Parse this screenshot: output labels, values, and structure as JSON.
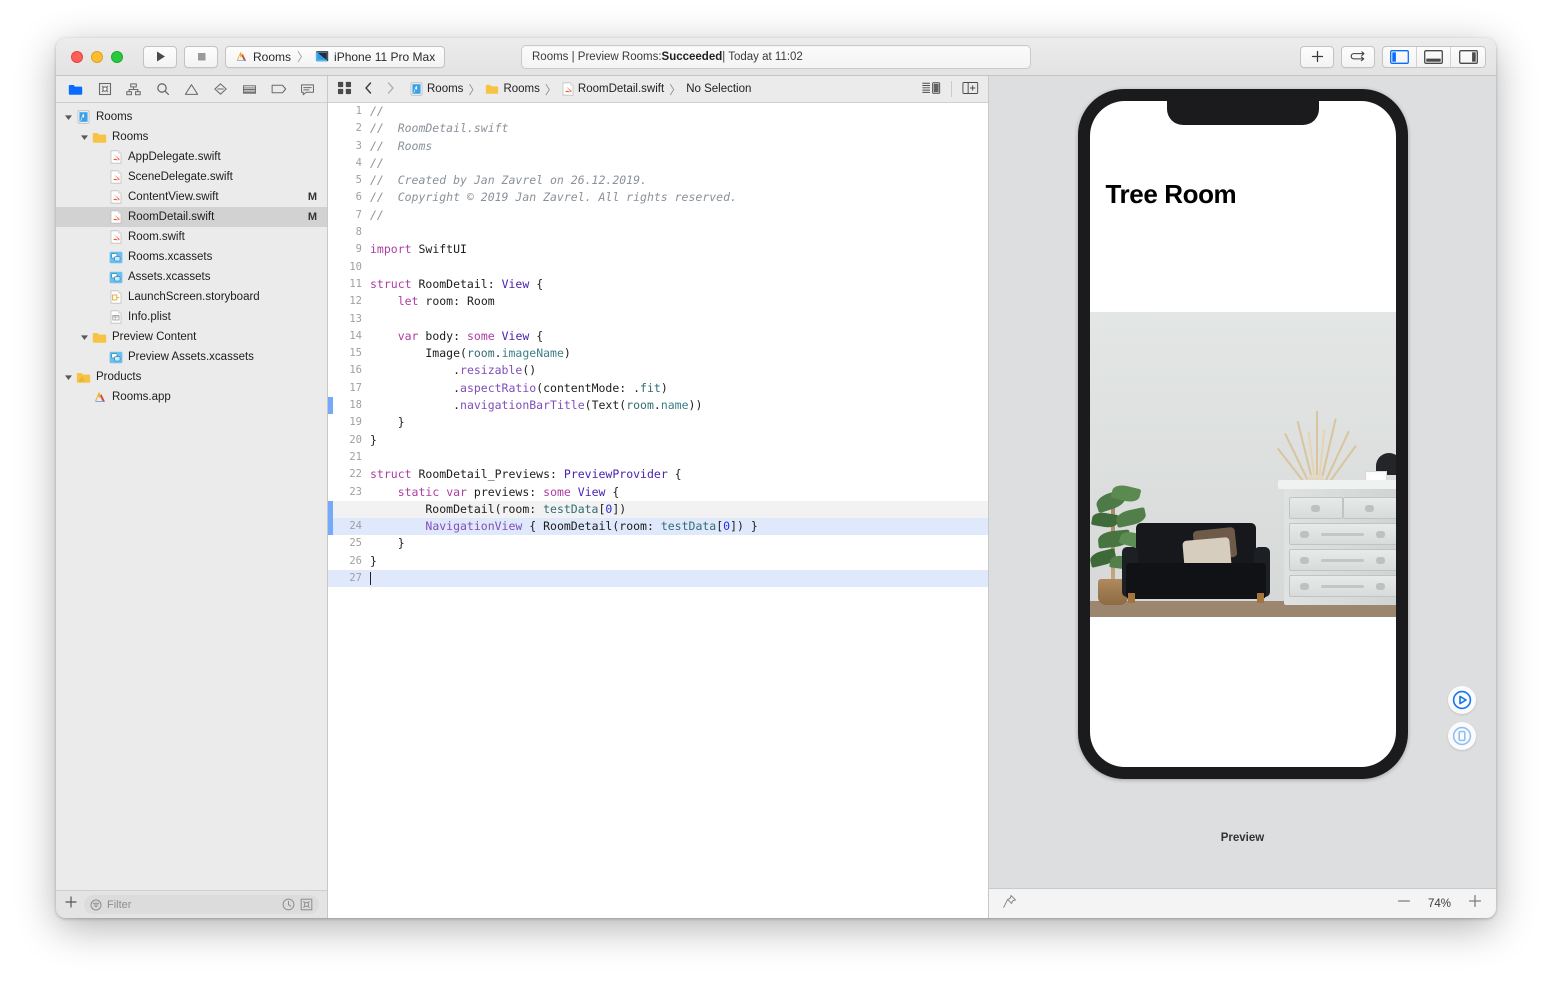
{
  "window": {
    "traffic_lights": [
      "close",
      "minimize",
      "zoom"
    ],
    "toolbar": {
      "run_label": "Run",
      "stop_label": "Stop",
      "scheme_name": "Rooms",
      "destination_name": "iPhone 11 Pro Max",
      "scheme_separator": "〉",
      "add_label": "+",
      "status": {
        "prefix": "Rooms | Preview Rooms: ",
        "result": "Succeeded",
        "suffix": " | Today at 11:02"
      },
      "editor_segments": [
        "standard-editor",
        "assistant-editor",
        "version-editor"
      ],
      "panel_toggles": [
        "navigator",
        "debug-area",
        "inspector"
      ]
    }
  },
  "navigator": {
    "tabs": [
      "project-navigator",
      "source-control-navigator",
      "symbol-navigator",
      "find-navigator",
      "issue-navigator",
      "test-navigator",
      "debug-navigator",
      "breakpoint-navigator",
      "report-navigator"
    ],
    "selected_tab": "project-navigator",
    "tree": [
      {
        "label": "Rooms",
        "icon": "xcode-project-icon",
        "depth": 0,
        "twisty": "down",
        "modified": "",
        "selected": false
      },
      {
        "label": "Rooms",
        "icon": "folder-icon",
        "depth": 1,
        "twisty": "down",
        "modified": "",
        "selected": false
      },
      {
        "label": "AppDelegate.swift",
        "icon": "swift-file-icon",
        "depth": 2,
        "twisty": "",
        "modified": "",
        "selected": false
      },
      {
        "label": "SceneDelegate.swift",
        "icon": "swift-file-icon",
        "depth": 2,
        "twisty": "",
        "modified": "",
        "selected": false
      },
      {
        "label": "ContentView.swift",
        "icon": "swift-file-icon",
        "depth": 2,
        "twisty": "",
        "modified": "M",
        "selected": false
      },
      {
        "label": "RoomDetail.swift",
        "icon": "swift-file-icon",
        "depth": 2,
        "twisty": "",
        "modified": "M",
        "selected": true
      },
      {
        "label": "Room.swift",
        "icon": "swift-file-icon",
        "depth": 2,
        "twisty": "",
        "modified": "",
        "selected": false
      },
      {
        "label": "Rooms.xcassets",
        "icon": "xcassets-icon",
        "depth": 2,
        "twisty": "",
        "modified": "",
        "selected": false
      },
      {
        "label": "Assets.xcassets",
        "icon": "xcassets-icon",
        "depth": 2,
        "twisty": "",
        "modified": "",
        "selected": false
      },
      {
        "label": "LaunchScreen.storyboard",
        "icon": "storyboard-icon",
        "depth": 2,
        "twisty": "",
        "modified": "",
        "selected": false
      },
      {
        "label": "Info.plist",
        "icon": "plist-icon",
        "depth": 2,
        "twisty": "",
        "modified": "",
        "selected": false
      },
      {
        "label": "Preview Content",
        "icon": "folder-icon",
        "depth": 1,
        "twisty": "down",
        "modified": "",
        "selected": false
      },
      {
        "label": "Preview Assets.xcassets",
        "icon": "xcassets-icon",
        "depth": 2,
        "twisty": "",
        "modified": "",
        "selected": false
      },
      {
        "label": "Products",
        "icon": "folder-build-icon",
        "depth": 0,
        "twisty": "down",
        "modified": "",
        "selected": false
      },
      {
        "label": "Rooms.app",
        "icon": "app-icon",
        "depth": 1,
        "twisty": "",
        "modified": "",
        "selected": false
      }
    ],
    "bottom_bar": {
      "add_label": "+",
      "filter_placeholder": "Filter",
      "recent_icon": "clock-icon",
      "scm_icon": "source-control-icon"
    }
  },
  "editor": {
    "jumpbar": {
      "related_items_icon": "related-items-icon",
      "back_icon": "chevron-left-icon",
      "forward_icon": "chevron-right-icon",
      "crumbs": [
        {
          "label": "Rooms",
          "icon": "xcode-project-icon"
        },
        {
          "label": "Rooms",
          "icon": "folder-icon"
        },
        {
          "label": "RoomDetail.swift",
          "icon": "swift-file-icon"
        },
        {
          "label": "No Selection",
          "icon": ""
        }
      ],
      "separator": "〉",
      "right_icons": [
        "minimap-toggle-icon",
        "add-editor-icon"
      ]
    },
    "filename": "RoomDetail.swift",
    "lines": [
      {
        "n": "1",
        "tokens": [
          {
            "t": "//",
            "c": "c"
          }
        ],
        "state": "",
        "gutter": false
      },
      {
        "n": "2",
        "tokens": [
          {
            "t": "//  RoomDetail.swift",
            "c": "c"
          }
        ],
        "state": "",
        "gutter": false
      },
      {
        "n": "3",
        "tokens": [
          {
            "t": "//  Rooms",
            "c": "c"
          }
        ],
        "state": "",
        "gutter": false
      },
      {
        "n": "4",
        "tokens": [
          {
            "t": "//",
            "c": "c"
          }
        ],
        "state": "",
        "gutter": false
      },
      {
        "n": "5",
        "tokens": [
          {
            "t": "//  Created by Jan Zavrel on 26.12.2019.",
            "c": "c"
          }
        ],
        "state": "",
        "gutter": false
      },
      {
        "n": "6",
        "tokens": [
          {
            "t": "//  Copyright © 2019 Jan Zavrel. All rights reserved.",
            "c": "c"
          }
        ],
        "state": "",
        "gutter": false
      },
      {
        "n": "7",
        "tokens": [
          {
            "t": "//",
            "c": "c"
          }
        ],
        "state": "",
        "gutter": false
      },
      {
        "n": "8",
        "tokens": [],
        "state": "",
        "gutter": false
      },
      {
        "n": "9",
        "tokens": [
          {
            "t": "import",
            "c": "k"
          },
          {
            "t": " SwiftUI",
            "c": ""
          }
        ],
        "state": "",
        "gutter": false
      },
      {
        "n": "10",
        "tokens": [],
        "state": "",
        "gutter": false
      },
      {
        "n": "11",
        "tokens": [
          {
            "t": "struct",
            "c": "k"
          },
          {
            "t": " RoomDetail",
            "c": ""
          },
          {
            "t": ": ",
            "c": ""
          },
          {
            "t": "View",
            "c": "ty"
          },
          {
            "t": " {",
            "c": ""
          }
        ],
        "state": "",
        "gutter": false
      },
      {
        "n": "12",
        "tokens": [
          {
            "t": "    ",
            "c": ""
          },
          {
            "t": "let",
            "c": "k"
          },
          {
            "t": " room",
            "c": ""
          },
          {
            "t": ": ",
            "c": ""
          },
          {
            "t": "Room",
            "c": ""
          }
        ],
        "state": "",
        "gutter": false
      },
      {
        "n": "13",
        "tokens": [],
        "state": "",
        "gutter": false
      },
      {
        "n": "14",
        "tokens": [
          {
            "t": "    ",
            "c": ""
          },
          {
            "t": "var",
            "c": "k"
          },
          {
            "t": " body",
            "c": ""
          },
          {
            "t": ": ",
            "c": ""
          },
          {
            "t": "some",
            "c": "k"
          },
          {
            "t": " ",
            "c": ""
          },
          {
            "t": "View",
            "c": "ty"
          },
          {
            "t": " {",
            "c": ""
          }
        ],
        "state": "",
        "gutter": false
      },
      {
        "n": "15",
        "tokens": [
          {
            "t": "        Image(",
            "c": ""
          },
          {
            "t": "room",
            "c": "m"
          },
          {
            "t": ".",
            "c": ""
          },
          {
            "t": "imageName",
            "c": "prop"
          },
          {
            "t": ")",
            "c": ""
          }
        ],
        "state": "",
        "gutter": false
      },
      {
        "n": "16",
        "tokens": [
          {
            "t": "            .",
            "c": ""
          },
          {
            "t": "resizable",
            "c": "p"
          },
          {
            "t": "()",
            "c": ""
          }
        ],
        "state": "",
        "gutter": false
      },
      {
        "n": "17",
        "tokens": [
          {
            "t": "            .",
            "c": ""
          },
          {
            "t": "aspectRatio",
            "c": "p"
          },
          {
            "t": "(contentMode: .",
            "c": ""
          },
          {
            "t": "fit",
            "c": "m"
          },
          {
            "t": ")",
            "c": ""
          }
        ],
        "state": "",
        "gutter": false
      },
      {
        "n": "18",
        "tokens": [
          {
            "t": "            .",
            "c": ""
          },
          {
            "t": "navigationBarTitle",
            "c": "p"
          },
          {
            "t": "(Text(",
            "c": ""
          },
          {
            "t": "room",
            "c": "m"
          },
          {
            "t": ".",
            "c": ""
          },
          {
            "t": "name",
            "c": "prop"
          },
          {
            "t": "))",
            "c": ""
          }
        ],
        "state": "",
        "gutter": true
      },
      {
        "n": "19",
        "tokens": [
          {
            "t": "    }",
            "c": ""
          }
        ],
        "state": "",
        "gutter": false
      },
      {
        "n": "20",
        "tokens": [
          {
            "t": "}",
            "c": ""
          }
        ],
        "state": "",
        "gutter": false
      },
      {
        "n": "21",
        "tokens": [],
        "state": "",
        "gutter": false
      },
      {
        "n": "22",
        "tokens": [
          {
            "t": "struct",
            "c": "k"
          },
          {
            "t": " RoomDetail_Previews",
            "c": ""
          },
          {
            "t": ": ",
            "c": ""
          },
          {
            "t": "PreviewProvider",
            "c": "ty"
          },
          {
            "t": " {",
            "c": ""
          }
        ],
        "state": "",
        "gutter": false
      },
      {
        "n": "23",
        "tokens": [
          {
            "t": "    ",
            "c": ""
          },
          {
            "t": "static",
            "c": "k"
          },
          {
            "t": " ",
            "c": ""
          },
          {
            "t": "var",
            "c": "k"
          },
          {
            "t": " previews",
            "c": ""
          },
          {
            "t": ": ",
            "c": ""
          },
          {
            "t": "some",
            "c": "k"
          },
          {
            "t": " ",
            "c": ""
          },
          {
            "t": "View",
            "c": "ty"
          },
          {
            "t": " {",
            "c": ""
          }
        ],
        "state": "",
        "gutter": false
      },
      {
        "n": "",
        "tokens": [
          {
            "t": "        RoomDetail(room: ",
            "c": ""
          },
          {
            "t": "testData",
            "c": "m"
          },
          {
            "t": "[",
            "c": ""
          },
          {
            "t": "0",
            "c": "n"
          },
          {
            "t": "])",
            "c": ""
          }
        ],
        "state": "ghost",
        "gutter": true
      },
      {
        "n": "24",
        "tokens": [
          {
            "t": "        ",
            "c": ""
          },
          {
            "t": "NavigationView",
            "c": "p"
          },
          {
            "t": " { RoomDetail(",
            "c": ""
          },
          {
            "t": "room",
            "c": ""
          },
          {
            "t": ": ",
            "c": ""
          },
          {
            "t": "testData",
            "c": "m"
          },
          {
            "t": "[",
            "c": ""
          },
          {
            "t": "0",
            "c": "n"
          },
          {
            "t": "]) }",
            "c": ""
          }
        ],
        "state": "hl",
        "gutter": true
      },
      {
        "n": "25",
        "tokens": [
          {
            "t": "    }",
            "c": ""
          }
        ],
        "state": "",
        "gutter": false
      },
      {
        "n": "26",
        "tokens": [
          {
            "t": "}",
            "c": ""
          }
        ],
        "state": "",
        "gutter": false
      },
      {
        "n": "27",
        "tokens": [],
        "state": "hl",
        "gutter": false,
        "caret": true
      }
    ]
  },
  "canvas": {
    "preview_label": "Preview",
    "device": "iPhone 11 Pro Max",
    "screen": {
      "navigation_title": "Tree Room",
      "image_description": "room-interior-photo"
    },
    "live_preview_icon": "play-circle-icon",
    "inspect_preview_icon": "device-circle-icon",
    "bottom_bar": {
      "pin_icon": "pin-icon",
      "zoom_out_icon": "minus-icon",
      "zoom_value": "74%",
      "zoom_in_icon": "plus-icon"
    }
  },
  "colors": {
    "accent_blue": "#0a6cff",
    "selection_blue": "#dfe9fb",
    "gutter_change": "#75a9f9",
    "keyword": "#ad3da4",
    "type": "#4b21b0",
    "method": "#326d74",
    "project_method": "#804fb8",
    "comment": "#8a9199",
    "number": "#272ad8"
  }
}
